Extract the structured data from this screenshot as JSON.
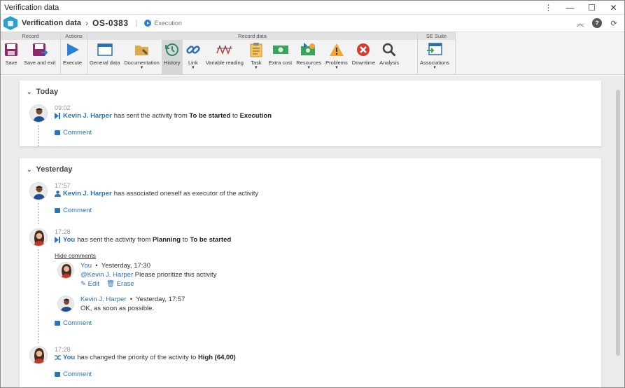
{
  "window": {
    "title": "Verification data",
    "buttons": [
      "⋮",
      "—",
      "☐",
      "✕"
    ]
  },
  "header": {
    "breadcrumb": "Verification data",
    "record_id": "OS-0383",
    "status": "Execution"
  },
  "ribbon": {
    "groups": [
      {
        "label": "Record",
        "items": [
          "Save",
          "Save and exit"
        ]
      },
      {
        "label": "Actions",
        "items": [
          "Execute"
        ]
      },
      {
        "label": "Record data",
        "items": [
          "General data",
          "Documentation",
          "History",
          "Link",
          "Variable reading",
          "Task",
          "Extra cost",
          "Resources",
          "Problems",
          "Downtime",
          "Analysis"
        ]
      },
      {
        "label": "SE Suite",
        "items": [
          "Associations"
        ]
      }
    ],
    "active": "History"
  },
  "today": {
    "title": "Today",
    "entry1": {
      "time": "09:02",
      "user": "Kevin J. Harper",
      "text_a": "has sent the activity from",
      "from": "To be started",
      "text_b": "to",
      "to": "Execution",
      "comment": "Comment"
    }
  },
  "yesterday": {
    "title": "Yesterday",
    "entry1": {
      "time": "17:57",
      "user": "Kevin J. Harper",
      "text": "has associated oneself as executor of the activity",
      "comment": "Comment"
    },
    "entry2": {
      "time": "17:28",
      "user": "You",
      "text_a": "has sent the activity from",
      "from": "Planning",
      "text_b": "to",
      "to": "To be started",
      "hide_comments": "Hide comments",
      "comments": [
        {
          "author": "You",
          "date": "Yesterday, 17:30",
          "mention": "@Kevin J. Harper",
          "text": "Please prioritize this activity",
          "edit": "Edit",
          "erase": "Erase"
        },
        {
          "author": "Kevin J. Harper",
          "date": "Yesterday, 17:57",
          "text": "OK, as soon as possible."
        }
      ],
      "comment": "Comment"
    },
    "entry3": {
      "time": "17:28",
      "user": "You",
      "text": "has changed the priority of the activity to",
      "priority": "High (64,00)",
      "comment": "Comment"
    }
  },
  "colors": {
    "accent": "#2d73b7",
    "save": "#8b2a6b",
    "execute": "#2a7fd6"
  }
}
